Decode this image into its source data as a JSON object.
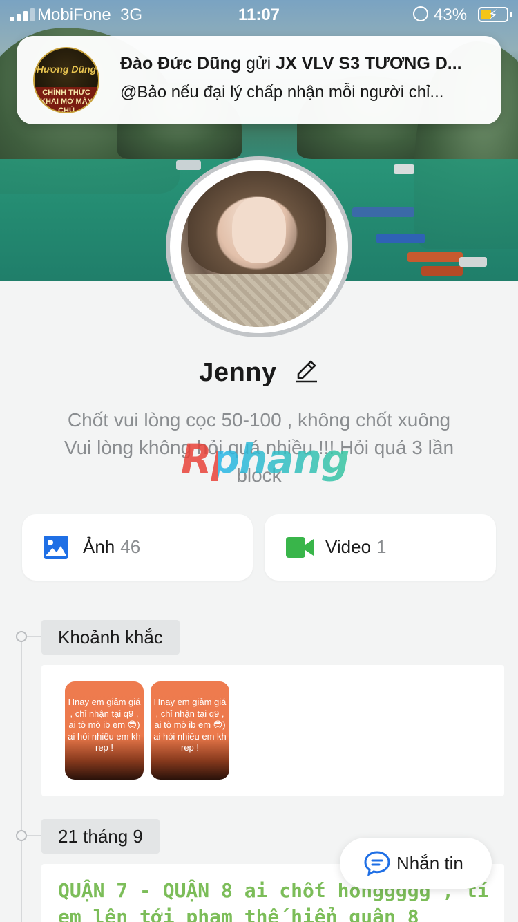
{
  "status_bar": {
    "carrier": "MobiFone",
    "network": "3G",
    "time": "11:07",
    "battery_pct": "43%",
    "battery_level": 0.43
  },
  "notification": {
    "sender": "Đào Đức Dũng",
    "verb": "gửi",
    "group": "JX VLV S3 TƯƠNG D...",
    "message": "@Bảo nếu đại lý chấp nhận mỗi người chỉ...",
    "thumb_line1": "Hương Dũng",
    "thumb_line2": "CHÍNH THỨC KHAI MỞ MÁY CHỦ"
  },
  "profile": {
    "name": "Jenny",
    "bio_line1": "Chốt vui lòng cọc 50-100 , không chốt xuông",
    "bio_line2": "Vui lòng không hỏi quá nhiều !!! Hỏi quá 3 lần",
    "bio_line3": "block",
    "watermark": "Rphang"
  },
  "media": {
    "photos_label": "Ảnh",
    "photos_count": "46",
    "videos_label": "Video",
    "videos_count": "1"
  },
  "timeline": {
    "moments_tag": "Khoảnh khắc",
    "stories": [
      {
        "text": "Hnay em giảm giá , chỉ nhận tại q9 , ai tò mò ib em 😎) ai hỏi nhiều em kh rep !"
      },
      {
        "text": "Hnay em giảm giá , chỉ nhận tại q9 , ai tò mò ib em 😎) ai hỏi nhiều em kh rep !"
      }
    ],
    "date_tag": "21 tháng 9",
    "post_line1": "QUẬN 7 - QUẬN 8 ai chốt honggggg , tí",
    "post_line2": "em lên tới phạm thế hiển quận 8"
  },
  "message_button": {
    "label": "Nhắn tin"
  },
  "colors": {
    "accent_blue": "#1f6fe5",
    "video_green": "#39b54a",
    "post_green": "#7cbd59"
  }
}
